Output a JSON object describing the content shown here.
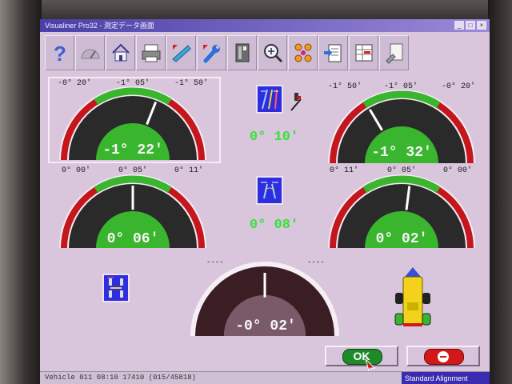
{
  "window": {
    "title": "Visualiner Pro32 - 測定データ画面",
    "controls": [
      "_",
      "□",
      "×"
    ]
  },
  "toolbar": {
    "buttons": [
      {
        "name": "help",
        "icon": "question-icon"
      },
      {
        "name": "gauge",
        "icon": "speedometer-icon"
      },
      {
        "name": "home",
        "icon": "house-icon"
      },
      {
        "name": "print",
        "icon": "printer-icon"
      },
      {
        "name": "measure",
        "icon": "ruler-gauge-icon"
      },
      {
        "name": "adjust",
        "icon": "wrench-icon"
      },
      {
        "name": "vehicle-spec",
        "icon": "spec-sheet-icon"
      },
      {
        "name": "zoom",
        "icon": "magnifier-icon"
      },
      {
        "name": "wheels",
        "icon": "wheel-layout-icon"
      },
      {
        "name": "report",
        "icon": "clipboard-icon"
      },
      {
        "name": "data",
        "icon": "data-table-icon"
      },
      {
        "name": "tools",
        "icon": "tool-sheet-icon"
      }
    ]
  },
  "readings": {
    "front_left_camber": {
      "min": "-0° 20'",
      "target": "-1° 05'",
      "max": "-1° 50'",
      "value": "-1°  22'",
      "fraction": 0.62,
      "selected": true
    },
    "front_right_camber": {
      "min": "-1° 50'",
      "target": "-1° 05'",
      "max": "-0° 20'",
      "value": "-1°  32'",
      "fraction": 0.33
    },
    "front_left_toe": {
      "min": "0° 00'",
      "target": "0° 05'",
      "max": "0° 11'",
      "value": "0°  06'",
      "fraction": 0.5
    },
    "front_right_toe": {
      "min": "0° 11'",
      "target": "0° 05'",
      "max": "0° 00'",
      "value": "0°  02'",
      "fraction": 0.54
    },
    "rear_thrust": {
      "min": "----",
      "max": "----",
      "value": "-0°  02'",
      "fraction": 0.5
    },
    "cross_camber": "0°  10'",
    "total_toe": "0°  08'"
  },
  "buttons": {
    "ok_label": "OK",
    "cancel_icon": "no-entry-icon"
  },
  "status": {
    "left": "Vehicle  011  08:10  17410 (015/45818)",
    "mode": "Standard Alignment"
  },
  "colors": {
    "background": "#d9c6dd",
    "gauge_red": "#c4161c",
    "gauge_green": "#39b52e",
    "value_green": "#39e03a"
  }
}
